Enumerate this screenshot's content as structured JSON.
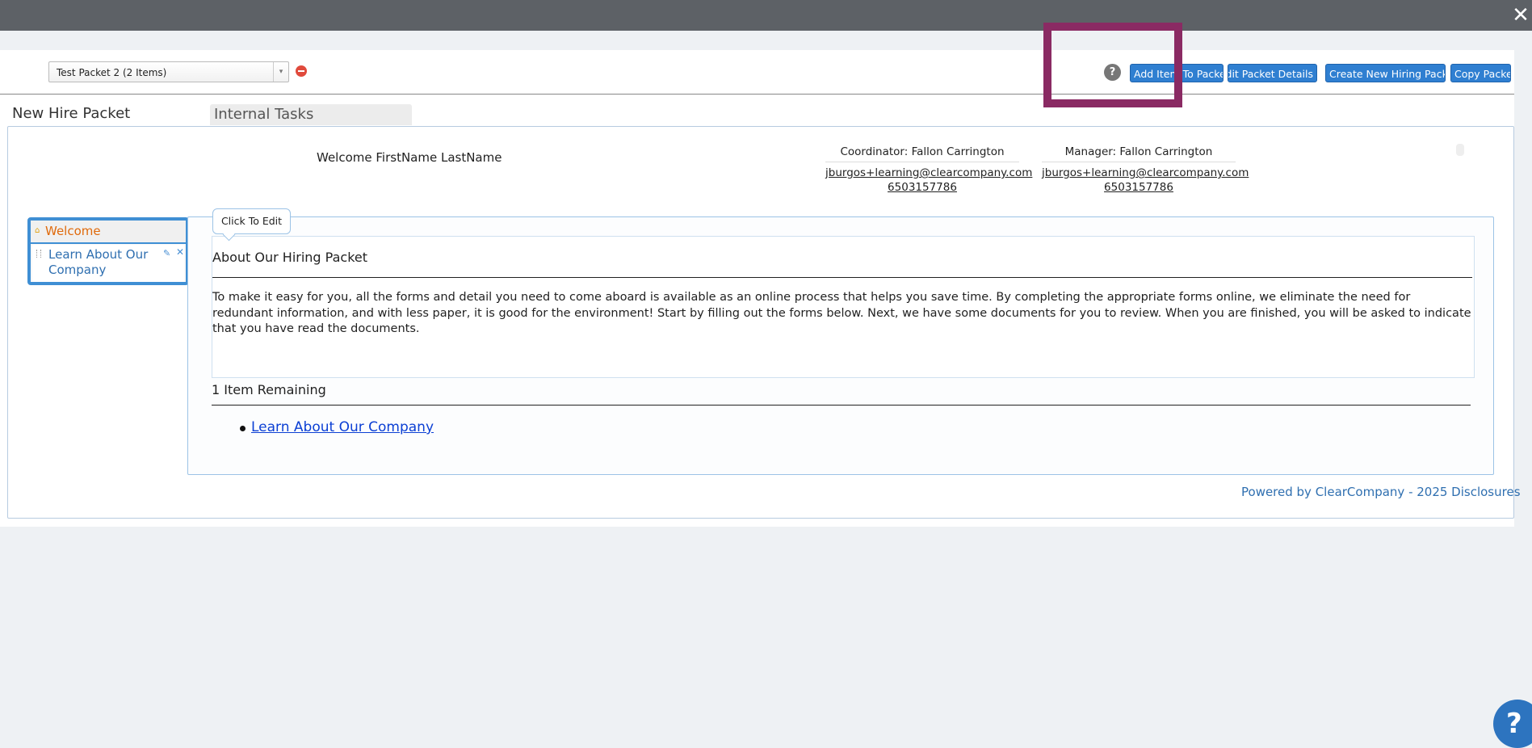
{
  "window": {
    "close_glyph": "✕"
  },
  "toolbar": {
    "packet_select": {
      "value": "Test Packet 2 (2 Items)",
      "arrow_glyph": "▾"
    },
    "help_glyph": "?",
    "buttons": {
      "add_item": "Add Item To Packet",
      "edit_details": "Edit Packet Details",
      "create_new": "Create New Hiring Packet",
      "copy": "Copy Packet"
    },
    "highlight_color": "#8a2a63",
    "button_color": "#2f7fd1"
  },
  "tabs": {
    "new_hire": "New Hire Packet",
    "internal": "Internal Tasks"
  },
  "header": {
    "welcome": "Welcome FirstName LastName",
    "coordinator": {
      "role": "Coordinator: Fallon Carrington",
      "email": "jburgos+learning@clearcompany.com",
      "phone": "6503157786"
    },
    "manager": {
      "role": "Manager: Fallon Carrington",
      "email": "jburgos+learning@clearcompany.com",
      "phone": "6503157786"
    }
  },
  "nav": {
    "welcome": "Welcome",
    "items": [
      {
        "label": "Learn About Our Company"
      }
    ]
  },
  "main": {
    "tooltip": "Click To Edit",
    "heading": "About Our Hiring Packet",
    "body": "To make it easy for you, all the forms and detail you need to come aboard is available as an online process that helps you save time. By completing the appropriate forms online, we eliminate the need for redundant information, and with less paper, it is good for the environment! Start by filling out the forms below. Next, we have some documents for you to review. When you are finished, you will be asked to indicate that you have read the documents.",
    "remaining_heading": "1 Item Remaining",
    "remaining_items": [
      "Learn About Our Company"
    ]
  },
  "footer": {
    "powered_by": "Powered by ClearCompany - 2025 Disclosures"
  },
  "help_fab": "?"
}
